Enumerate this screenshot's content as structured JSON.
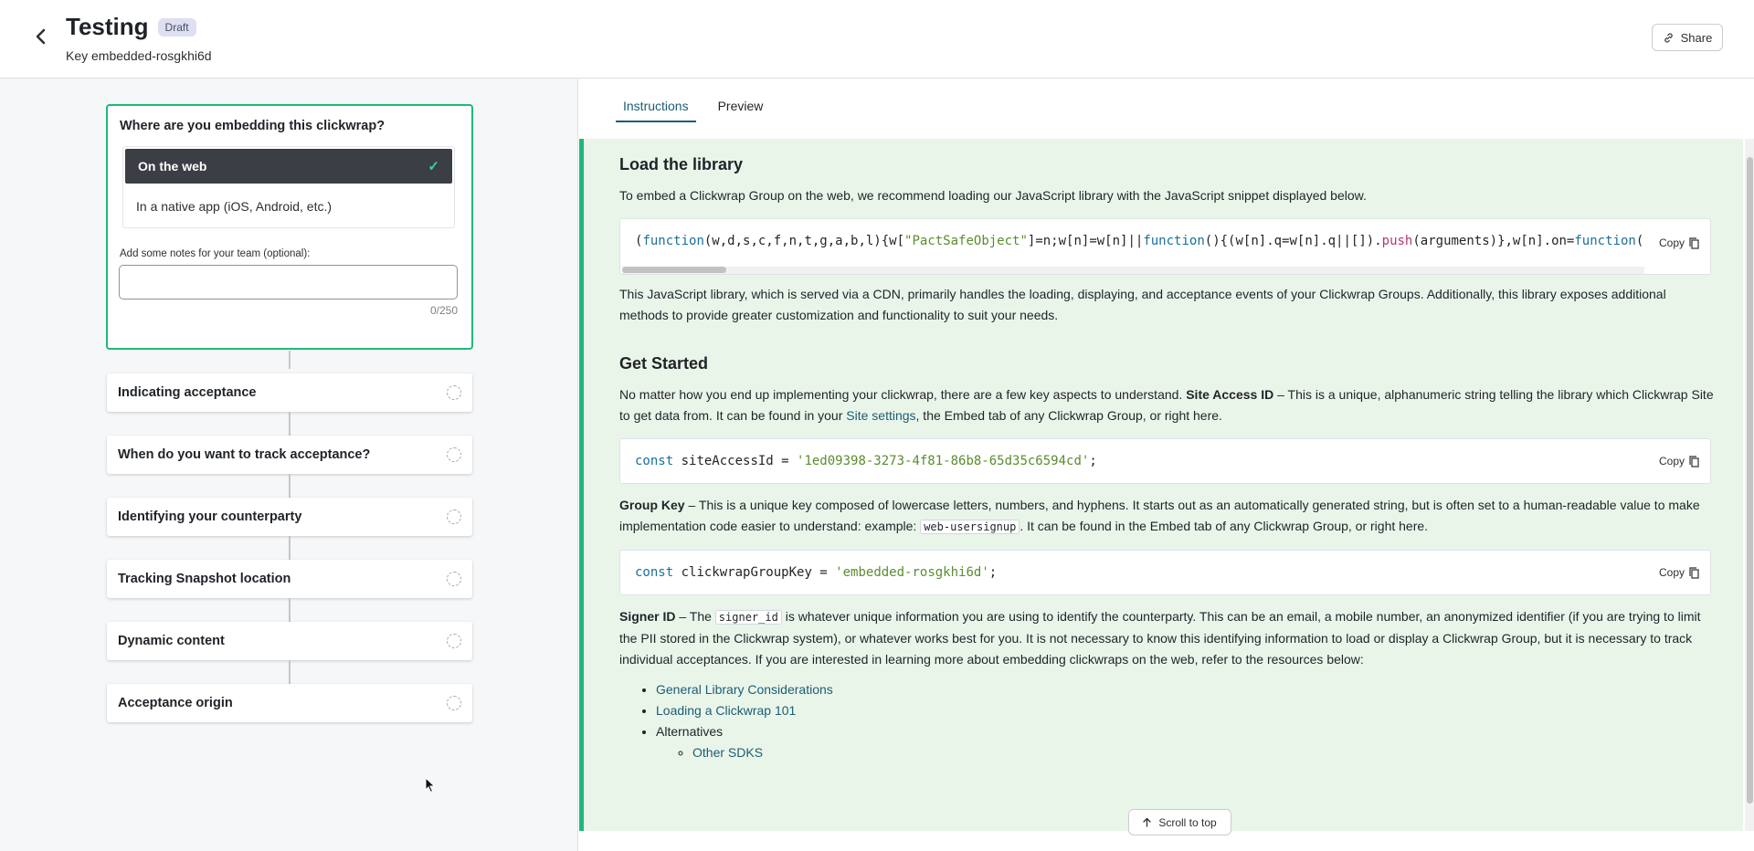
{
  "header": {
    "title": "Testing",
    "status_badge": "Draft",
    "subtitle": "Key embedded-rosgkhi6d",
    "share_label": "Share"
  },
  "setup": {
    "question": "Where are you embedding this clickwrap?",
    "options": [
      {
        "label": "On the web",
        "selected": true
      },
      {
        "label": "In a native app (iOS, Android, etc.)",
        "selected": false
      }
    ],
    "notes_label": "Add some notes for your team (optional):",
    "notes_value": "",
    "notes_counter": "0/250",
    "steps": [
      "Indicating acceptance",
      "When do you want to track acceptance?",
      "Identifying your counterparty",
      "Tracking Snapshot location",
      "Dynamic content",
      "Acceptance origin"
    ]
  },
  "tabs": {
    "instructions": "Instructions",
    "preview": "Preview"
  },
  "instructions": {
    "load_heading": "Load the library",
    "load_intro": "To embed a Clickwrap Group on the web, we recommend loading our JavaScript library with the JavaScript snippet displayed below.",
    "snippet": {
      "p1": "(",
      "fn": "function",
      "p2": "(w,d,s,c,f,n,t,g,a,b,l){w[",
      "str": "\"PactSafeObject\"",
      "p3": "]=n;w[n]=w[n]||",
      "fn2": "function",
      "p4": "(){(w[n].q=w[n].q||[]).",
      "push": "push",
      "p5": "(arguments)},w[n].on=",
      "fn3": "function",
      "p6": "()"
    },
    "copy_label": "Copy",
    "library_desc": "This JavaScript library, which is served via a CDN, primarily handles the loading, displaying, and acceptance events of your Clickwrap Groups. Additionally, this library exposes additional methods to provide greater customization and functionality to suit your needs.",
    "start_heading": "Get Started",
    "start_intro": "No matter how you end up implementing your clickwrap, there are a few key aspects to understand.",
    "site_term": "Site Access ID",
    "site_desc": " – This is a unique, alphanumeric string telling the library which Clickwrap Site to get data from. It can be found in your ",
    "site_link": "Site settings",
    "site_desc2": ", the Embed tab of any Clickwrap Group, or right here.",
    "site_code": {
      "kw": "const",
      "var": " siteAccessId = ",
      "str": "'1ed09398-3273-4f81-86b8-65d35c6594cd'",
      "end": ";"
    },
    "group_term": "Group Key",
    "group_desc": " – This is a unique key composed of lowercase letters, numbers, and hyphens. It starts out as an automatically generated string, but is often set to a human-readable value to make implementation code easier to understand: example: ",
    "group_example": "web-usersignup",
    "group_desc2": ". It can be found in the Embed tab of any Clickwrap Group, or right here.",
    "group_code": {
      "kw": "const",
      "var": " clickwrapGroupKey = ",
      "str": "'embedded-rosgkhi6d'",
      "end": ";"
    },
    "signer_term": "Signer ID",
    "signer_pre": " – The ",
    "signer_code": "signer_id",
    "signer_desc": " is whatever unique information you are using to identify the counterparty. This can be an email, a mobile number, an anonymized identifier (if you are trying to limit the PII stored in the Clickwrap system), or whatever works best for you. It is not necessary to know this identifying information to load or display a Clickwrap Group, but it is necessary to track individual acceptances. If you are interested in learning more about embedding clickwraps on the web, refer to the resources below:",
    "resources": {
      "link1": "General Library Considerations",
      "link2": "Loading a Clickwrap 101",
      "alternatives": "Alternatives",
      "sublink": "Other SDKS"
    },
    "scroll_top": "Scroll to top"
  }
}
